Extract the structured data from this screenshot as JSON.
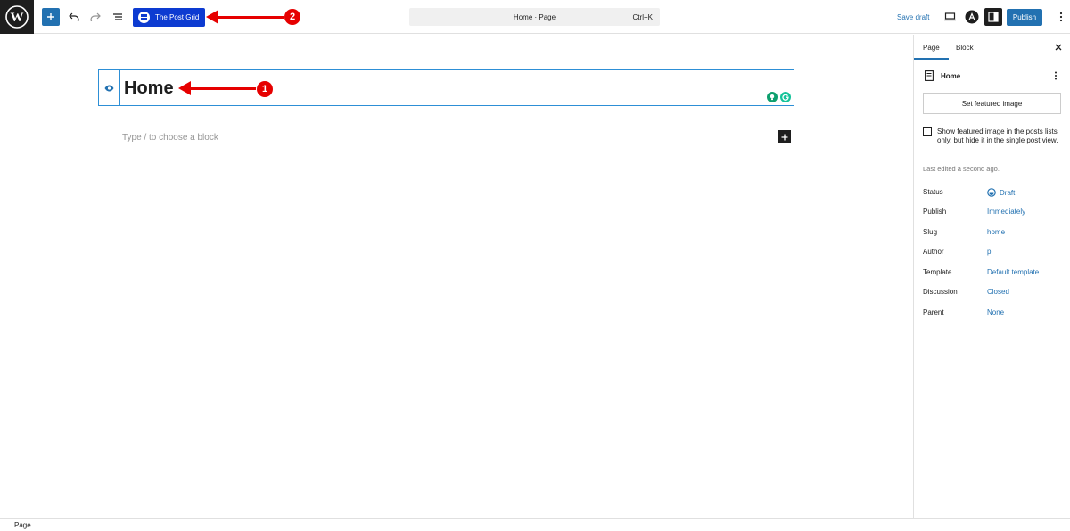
{
  "header": {
    "post_grid_label": "The Post Grid",
    "command_title": "Home · Page",
    "command_shortcut": "Ctrl+K",
    "save_draft_label": "Save draft",
    "publish_label": "Publish"
  },
  "editor": {
    "title": "Home",
    "placeholder": "Type / to choose a block"
  },
  "annotations": [
    {
      "number": "1"
    },
    {
      "number": "2"
    }
  ],
  "sidebar": {
    "tabs": [
      {
        "label": "Page",
        "active": true
      },
      {
        "label": "Block",
        "active": false
      }
    ],
    "doc_title": "Home",
    "featured_image_label": "Set featured image",
    "featured_checkbox_label": "Show featured image in the posts lists only, but hide it in the single post view.",
    "featured_checkbox_checked": false,
    "last_edited": "Last edited a second ago.",
    "meta": [
      {
        "label": "Status",
        "value": "Draft"
      },
      {
        "label": "Publish",
        "value": "Immediately"
      },
      {
        "label": "Slug",
        "value": "home"
      },
      {
        "label": "Author",
        "value": "p"
      },
      {
        "label": "Template",
        "value": "Default template"
      },
      {
        "label": "Discussion",
        "value": "Closed"
      },
      {
        "label": "Parent",
        "value": "None"
      }
    ]
  },
  "footer": {
    "breadcrumb": "Page"
  },
  "colors": {
    "accent": "#2271b1",
    "post_grid": "#0d3bd1",
    "annotation": "#e60000",
    "extension_green": "#0e9f6e"
  }
}
